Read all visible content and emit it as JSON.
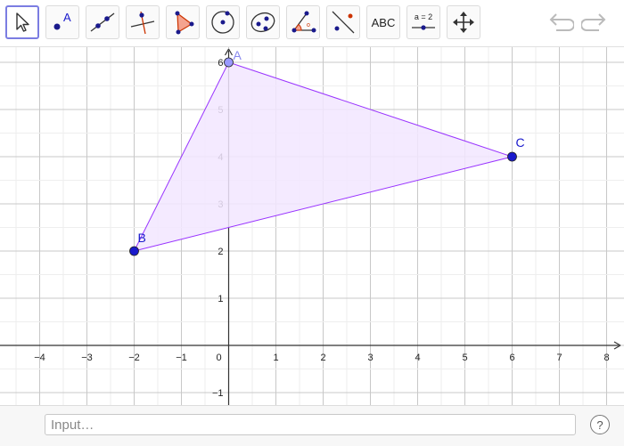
{
  "toolbar": {
    "tools": [
      {
        "name": "move-tool-button",
        "label": "",
        "icon": "arrow-cursor-icon",
        "selected": true
      },
      {
        "name": "point-tool-button",
        "label": "A",
        "icon": "point-icon"
      },
      {
        "name": "line-tool-button",
        "label": "",
        "icon": "line-through-two-points-icon"
      },
      {
        "name": "perpendicular-tool-button",
        "label": "",
        "icon": "perpendicular-line-icon"
      },
      {
        "name": "polygon-tool-button",
        "label": "",
        "icon": "polygon-icon"
      },
      {
        "name": "circle-tool-button",
        "label": "",
        "icon": "circle-center-point-icon"
      },
      {
        "name": "ellipse-tool-button",
        "label": "",
        "icon": "ellipse-icon"
      },
      {
        "name": "angle-tool-button",
        "label": "",
        "icon": "angle-icon"
      },
      {
        "name": "reflect-tool-button",
        "label": "",
        "icon": "reflect-about-line-icon"
      },
      {
        "name": "text-tool-button",
        "label": "ABC",
        "icon": "text-icon"
      },
      {
        "name": "slider-tool-button",
        "label": "a = 2",
        "icon": "slider-icon"
      },
      {
        "name": "move-view-tool-button",
        "label": "",
        "icon": "move-graphics-view-icon"
      }
    ],
    "undo_icon": "undo-icon",
    "redo_icon": "redo-icon"
  },
  "graphics": {
    "x_ticks": [
      "−4",
      "−3",
      "−2",
      "−1",
      "0",
      "1",
      "2",
      "3",
      "4",
      "5",
      "6",
      "7",
      "8"
    ],
    "y_ticks": [
      "−1",
      "1",
      "2",
      "3",
      "4",
      "5",
      "6"
    ],
    "points": [
      {
        "label": "A",
        "x": 0,
        "y": 6,
        "color": "#9999ff"
      },
      {
        "label": "B",
        "x": -2,
        "y": 2,
        "color": "#1a1acc"
      },
      {
        "label": "C",
        "x": 6,
        "y": 4,
        "color": "#1a1acc"
      }
    ],
    "polygon_color": "#9933ff",
    "polygon_fill": "#f2e6ff"
  },
  "input_bar": {
    "placeholder": "Input…",
    "help_label": "?"
  }
}
